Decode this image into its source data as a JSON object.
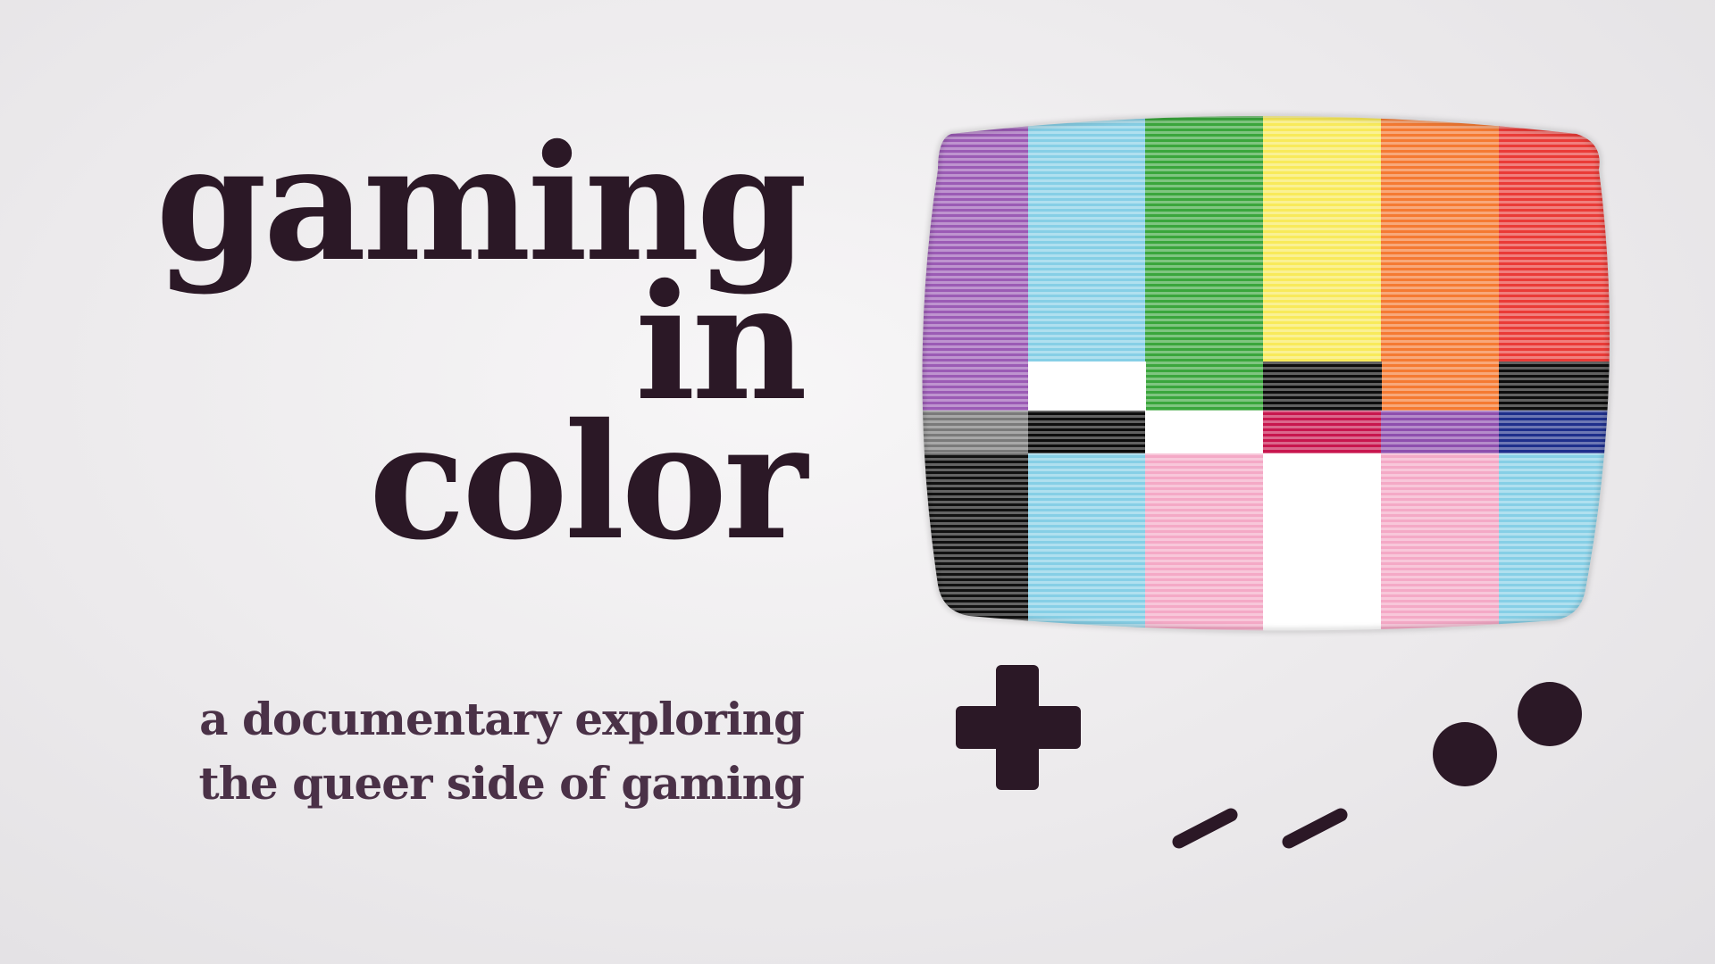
{
  "title": {
    "line1": "gaming",
    "line2": "in",
    "line3": "color"
  },
  "subtitle": {
    "line1": "a documentary exploring",
    "line2": "the queer side of gaming"
  },
  "colors": {
    "title": "#2b1826",
    "subtitle": "#4a3147",
    "controls": "#2b1826",
    "bars_top": [
      "#9b5bb5",
      "#86cfe6",
      "#3aa63c",
      "#f8ea5a",
      "#f57a32",
      "#ea3b37"
    ],
    "bars_bottom": [
      "#111111",
      "#86cfe6",
      "#f4a9c6",
      "#ffffff",
      "#f4a9c6",
      "#86cfe6"
    ]
  },
  "icons": [
    "d-pad-icon",
    "a-button-icon",
    "b-button-icon",
    "select-button-icon",
    "start-button-icon",
    "crt-tv-screen-icon"
  ]
}
